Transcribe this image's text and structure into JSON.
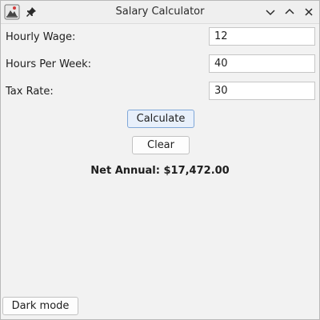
{
  "window": {
    "title": "Salary Calculator",
    "icons": {
      "app": "java-app-icon",
      "pin": "pin-icon",
      "minimize": "chevron-down-icon",
      "maximize": "chevron-up-icon",
      "close": "close-icon"
    }
  },
  "form": {
    "hourly_wage": {
      "label": "Hourly Wage:",
      "value": "12"
    },
    "hours_per_week": {
      "label": "Hours Per Week:",
      "value": "40"
    },
    "tax_rate": {
      "label": "Tax Rate:",
      "value": "30"
    }
  },
  "actions": {
    "calculate_label": "Calculate",
    "clear_label": "Clear",
    "dark_mode_label": "Dark mode"
  },
  "result": {
    "text": "Net Annual: $17,472.00"
  },
  "colors": {
    "background": "#f2f2f2",
    "field_border": "#c6c6c6",
    "focused_button_bg": "#e8f0fb",
    "focused_button_border": "#7fa7d8"
  }
}
